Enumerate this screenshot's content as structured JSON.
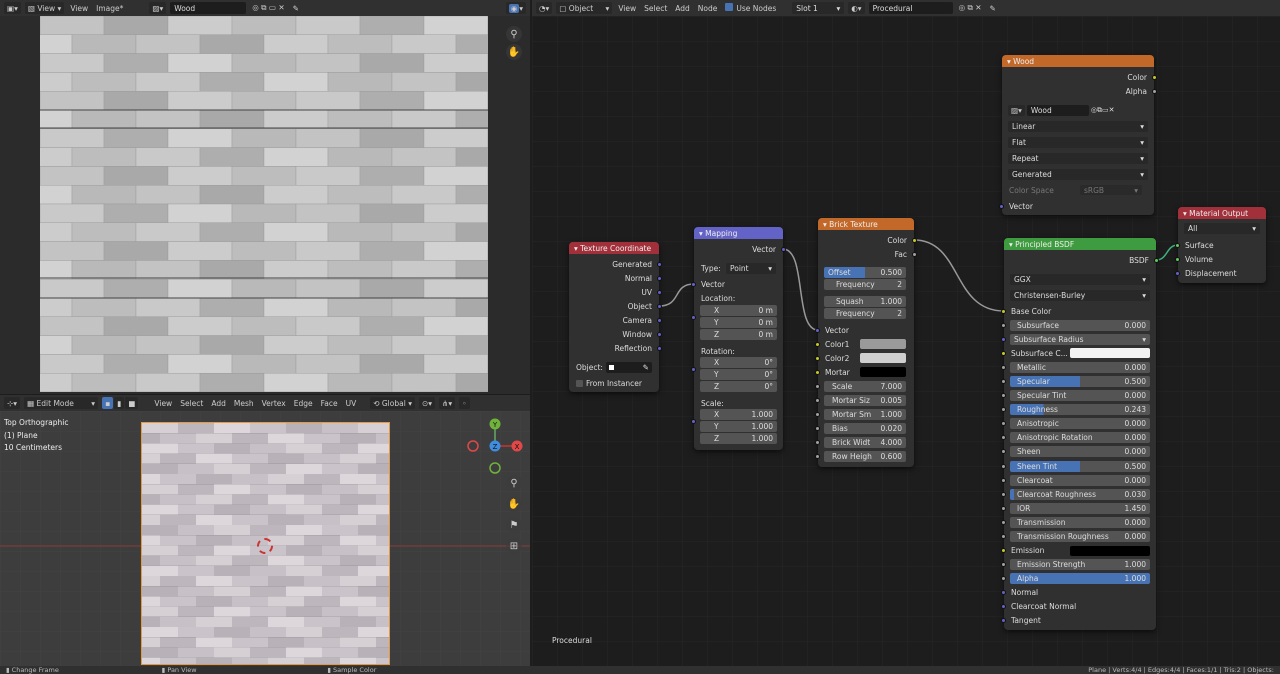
{
  "image_editor": {
    "menu": [
      "View",
      "Image*"
    ],
    "view_label": "View",
    "image_name": "Wood"
  },
  "viewport3d": {
    "mode": "Edit Mode",
    "menu": [
      "View",
      "Select",
      "Add",
      "Mesh",
      "Vertex",
      "Edge",
      "Face",
      "UV"
    ],
    "transform": "Global",
    "info": [
      "Top Orthographic",
      "(1) Plane",
      "10 Centimeters"
    ],
    "gizmo": {
      "x": "X",
      "y": "Y",
      "z": "Z"
    }
  },
  "node_editor": {
    "type": "Object",
    "menu": [
      "View",
      "Select",
      "Add",
      "Node"
    ],
    "use_nodes": "Use Nodes",
    "slot": "Slot 1",
    "material": "Procedural",
    "footer_label": "Procedural"
  },
  "nodes": {
    "texcoord": {
      "title": "Texture Coordinate",
      "outputs": [
        "Generated",
        "Normal",
        "UV",
        "Object",
        "Camera",
        "Window",
        "Reflection"
      ],
      "object_label": "Object:",
      "from_instancer": "From Instancer"
    },
    "mapping": {
      "title": "Mapping",
      "out": "Vector",
      "type_label": "Type:",
      "type_value": "Point",
      "vector": "Vector",
      "location": "Location:",
      "loc": [
        [
          "X",
          "0 m"
        ],
        [
          "Y",
          "0 m"
        ],
        [
          "Z",
          "0 m"
        ]
      ],
      "rotation": "Rotation:",
      "rot": [
        [
          "X",
          "0°"
        ],
        [
          "Y",
          "0°"
        ],
        [
          "Z",
          "0°"
        ]
      ],
      "scale": "Scale:",
      "scl": [
        [
          "X",
          "1.000"
        ],
        [
          "Y",
          "1.000"
        ],
        [
          "Z",
          "1.000"
        ]
      ]
    },
    "brick": {
      "title": "Brick Texture",
      "outputs": [
        "Color",
        "Fac"
      ],
      "offset": [
        "Offset",
        "0.500"
      ],
      "freq1": [
        "Frequency",
        "2"
      ],
      "squash": [
        "Squash",
        "1.000"
      ],
      "freq2": [
        "Frequency",
        "2"
      ],
      "vector": "Vector",
      "color1": "Color1",
      "color2": "Color2",
      "mortar": "Mortar",
      "params": [
        [
          "Scale",
          "7.000"
        ],
        [
          "Mortar Siz",
          "0.005"
        ],
        [
          "Mortar Sm",
          "1.000"
        ],
        [
          "Bias",
          "0.020"
        ],
        [
          "Brick Widt",
          "4.000"
        ],
        [
          "Row Heigh",
          "0.600"
        ]
      ]
    },
    "wood": {
      "title": "Wood",
      "outputs": [
        "Color",
        "Alpha"
      ],
      "image": "Wood",
      "dropdowns": [
        "Linear",
        "Flat",
        "Repeat",
        "Generated"
      ],
      "colorspace_label": "Color Space",
      "colorspace_value": "sRGB",
      "vector": "Vector"
    },
    "output": {
      "title": "Material Output",
      "target": "All",
      "inputs": [
        "Surface",
        "Volume",
        "Displacement"
      ]
    },
    "bsdf": {
      "title": "Principled BSDF",
      "out": "BSDF",
      "dist": "GGX",
      "sss": "Christensen-Burley",
      "base_color": "Base Color",
      "rows": [
        [
          "Subsurface",
          "0.000",
          0
        ],
        [
          "Subsurface Radius",
          "",
          0
        ],
        [
          "Subsurface C...",
          "",
          0
        ],
        [
          "Metallic",
          "0.000",
          0
        ],
        [
          "Specular",
          "0.500",
          0.5
        ],
        [
          "Specular Tint",
          "0.000",
          0
        ],
        [
          "Roughness",
          "0.243",
          0.243
        ],
        [
          "Anisotropic",
          "0.000",
          0
        ],
        [
          "Anisotropic Rotation",
          "0.000",
          0
        ],
        [
          "Sheen",
          "0.000",
          0
        ],
        [
          "Sheen Tint",
          "0.500",
          0.5
        ],
        [
          "Clearcoat",
          "0.000",
          0
        ],
        [
          "Clearcoat Roughness",
          "0.030",
          0.03
        ],
        [
          "IOR",
          "1.450",
          0
        ],
        [
          "Transmission",
          "0.000",
          0
        ],
        [
          "Transmission Roughness",
          "0.000",
          0
        ],
        [
          "Emission",
          "",
          0
        ],
        [
          "Emission Strength",
          "1.000",
          0
        ],
        [
          "Alpha",
          "1.000",
          1
        ]
      ],
      "vec_inputs": [
        "Normal",
        "Clearcoat Normal",
        "Tangent"
      ]
    }
  },
  "statusbar": {
    "left": [
      "Change Frame",
      "Pan View",
      "Sample Color"
    ],
    "right": "Plane | Verts:4/4 | Edges:4/4 | Faces:1/1 | Tris:2 | Objects:"
  }
}
